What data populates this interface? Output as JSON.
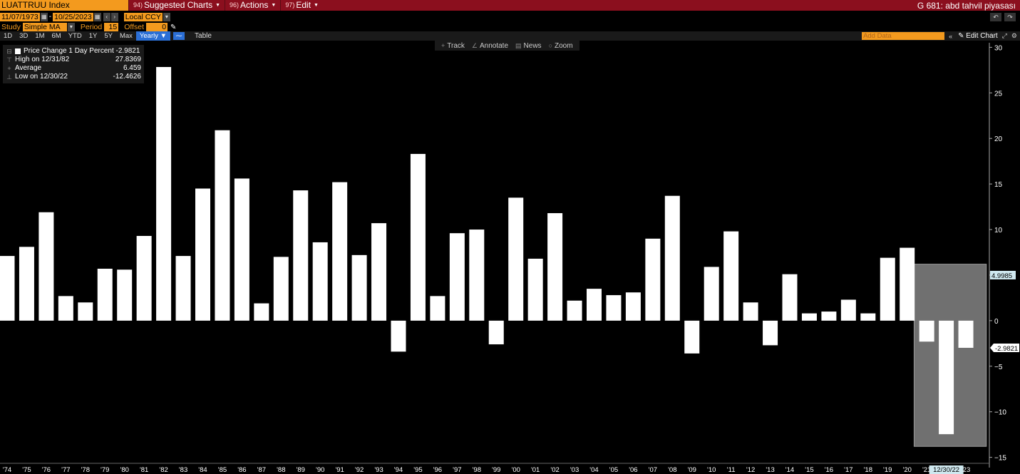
{
  "header": {
    "ticker": "LUATTRUU Index",
    "menu": [
      {
        "num": "94)",
        "label": "Suggested Charts"
      },
      {
        "num": "96)",
        "label": "Actions"
      },
      {
        "num": "97)",
        "label": "Edit"
      }
    ],
    "right_title": "G 681: abd tahvil piyasası"
  },
  "controls": {
    "start_date": "11/07/1973",
    "end_date": "10/25/2023",
    "date_separator": "-",
    "currency": "Local CCY",
    "study_label": "Study",
    "study_value": "Simple MA",
    "period_label": "Period",
    "period_value": "15",
    "offset_label": "Offset",
    "offset_value": "0"
  },
  "toolbar": {
    "ranges": [
      "1D",
      "3D",
      "1M",
      "6M",
      "YTD",
      "1Y",
      "5Y",
      "Max"
    ],
    "frequency": "Yearly",
    "table_label": "Table",
    "add_data_placeholder": "Add Data",
    "edit_chart_label": "Edit Chart"
  },
  "tools": [
    {
      "icon": "+",
      "label": "Track"
    },
    {
      "icon": "∠",
      "label": "Annotate"
    },
    {
      "icon": "▤",
      "label": "News"
    },
    {
      "icon": "○",
      "label": "Zoom"
    }
  ],
  "legend": {
    "series_name": "Price Change 1 Day Percent",
    "series_value": "-2.9821",
    "high_label": "High on 12/31/82",
    "high_value": "27.8369",
    "avg_label": "Average",
    "avg_value": "6.459",
    "low_label": "Low on 12/30/22",
    "low_value": "-12.4626"
  },
  "colors": {
    "bar": "#ffffff",
    "highlight_box": "#707070",
    "topbar": "#8b0f1e",
    "accent_orange": "#f39a1e",
    "last_value_tag": "#ffffff",
    "ma_tag": "#cfe8ef"
  },
  "chart_data": {
    "type": "bar",
    "categories": [
      "'74",
      "'75",
      "'76",
      "'77",
      "'78",
      "'79",
      "'80",
      "'81",
      "'82",
      "'83",
      "'84",
      "'85",
      "'86",
      "'87",
      "'88",
      "'89",
      "'90",
      "'91",
      "'92",
      "'93",
      "'94",
      "'95",
      "'96",
      "'97",
      "'98",
      "'99",
      "'00",
      "'01",
      "'02",
      "'03",
      "'04",
      "'05",
      "'06",
      "'07",
      "'08",
      "'09",
      "'10",
      "'11",
      "'12",
      "'13",
      "'14",
      "'15",
      "'16",
      "'17",
      "'18",
      "'19",
      "'20",
      "'21",
      "'22",
      "'23"
    ],
    "values": [
      7.1,
      8.1,
      11.9,
      2.7,
      2.0,
      5.7,
      5.6,
      9.3,
      27.84,
      7.1,
      14.5,
      20.9,
      15.6,
      1.9,
      7.0,
      14.3,
      8.6,
      15.2,
      7.2,
      10.7,
      -3.4,
      18.3,
      2.7,
      9.6,
      10.0,
      -2.6,
      13.5,
      6.8,
      11.8,
      2.2,
      3.5,
      2.8,
      3.1,
      9.0,
      13.7,
      -3.6,
      5.9,
      9.8,
      2.0,
      -2.7,
      5.1,
      0.8,
      1.0,
      2.3,
      0.8,
      6.9,
      8.0,
      -2.3,
      -12.46,
      -2.98
    ],
    "ylim": [
      -15.5,
      30.5
    ],
    "yticks": [
      -15,
      -10,
      -5,
      0,
      5,
      10,
      15,
      20,
      25,
      30
    ],
    "last_value": -2.9821,
    "ma_value": 4.9985,
    "highlight_label": "12/30/22",
    "highlight_range": [
      "'21",
      "'23"
    ],
    "highlight_box_top_value": 6.2,
    "highlight_box_bottom_value": -13.8
  }
}
